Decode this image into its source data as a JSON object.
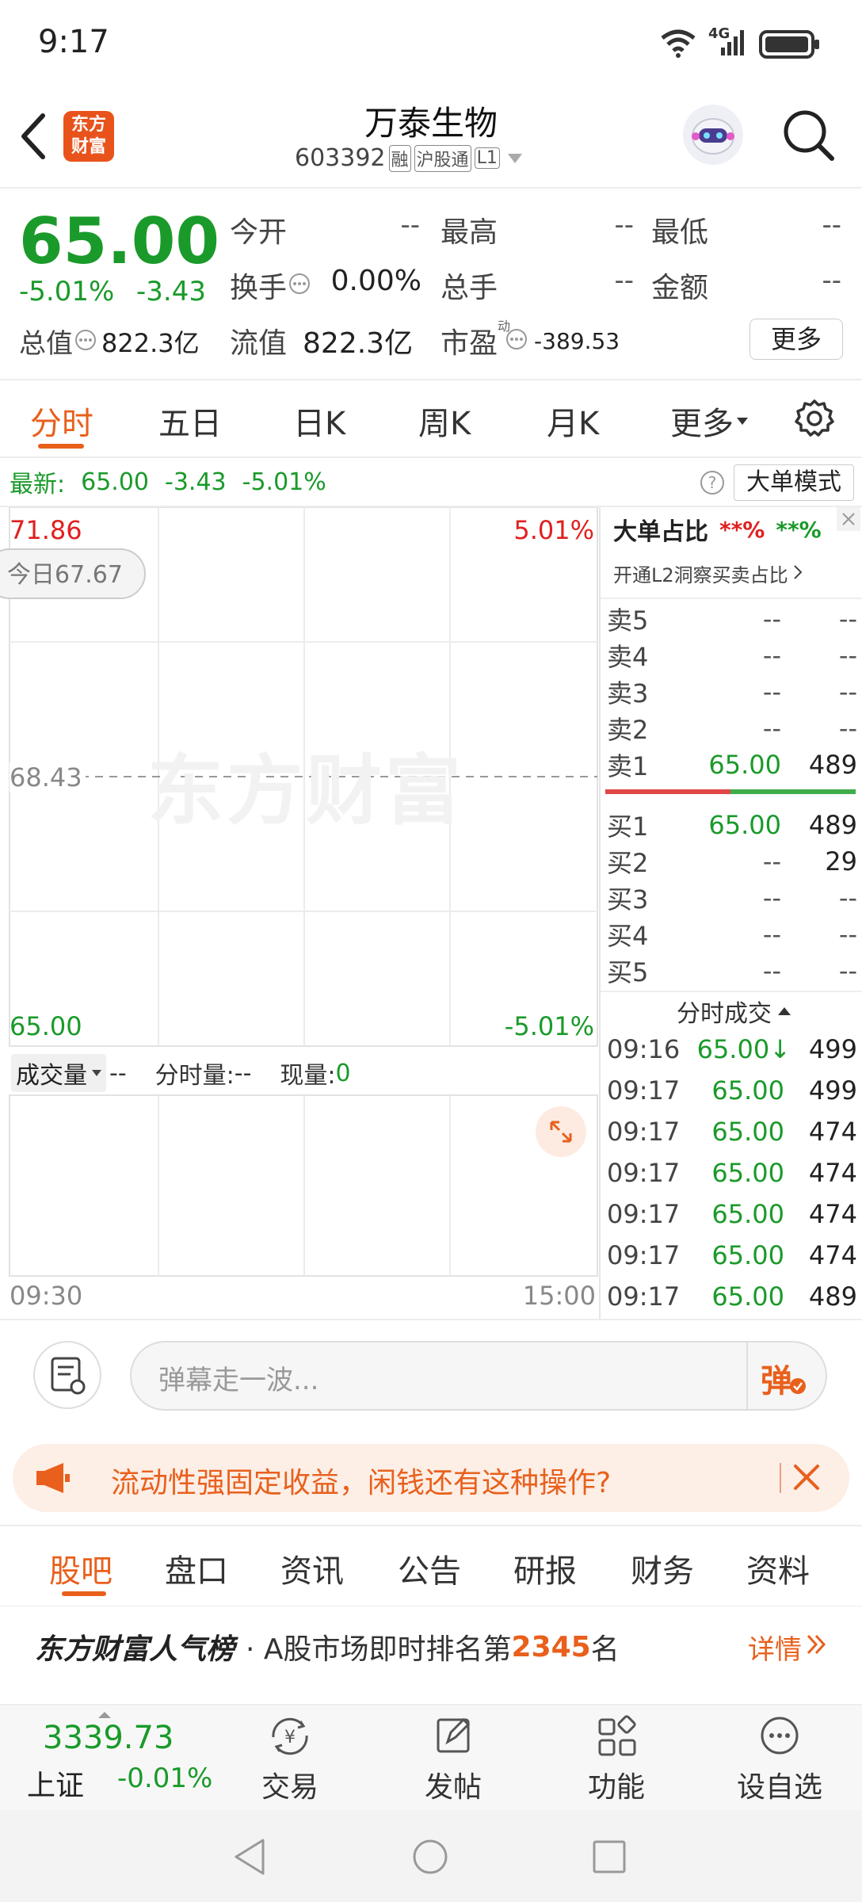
{
  "status_bar": {
    "time": "9:17",
    "network": "4G"
  },
  "header": {
    "logo_top": "东方",
    "logo_bottom": "财富",
    "stock_name": "万泰生物",
    "stock_code": "603392",
    "tags": [
      "融",
      "沪股通",
      "L1"
    ]
  },
  "quote": {
    "price": "65.00",
    "change_pct": "-5.01%",
    "change_abs": "-3.43",
    "open_label": "今开",
    "open_value": "--",
    "high_label": "最高",
    "high_value": "--",
    "low_label": "最低",
    "low_value": "--",
    "turnover_label": "换手",
    "turnover_value": "0.00%",
    "volume_label": "总手",
    "volume_value": "--",
    "amount_label": "金额",
    "amount_value": "--",
    "mktcap_label": "总值",
    "mktcap_value": "822.3亿",
    "float_label": "流值",
    "float_value": "822.3亿",
    "pe_label": "市盈",
    "pe_sup": "动",
    "pe_value": "-389.53",
    "more_button": "更多"
  },
  "chart_tabs": [
    "分时",
    "五日",
    "日K",
    "周K",
    "月K",
    "更多"
  ],
  "latest_bar": {
    "label": "最新:",
    "price": "65.00",
    "change": "-3.43",
    "pct": "-5.01%",
    "mode_button": "大单模式"
  },
  "chart": {
    "y_top": "71.86",
    "y_top_pct": "5.01%",
    "today_pill": "今日67.67",
    "y_mid": "68.43",
    "y_bottom": "65.00",
    "y_bottom_pct": "-5.01%",
    "watermark": "东方财富",
    "volume_selector": "成交量",
    "volume_value": "--",
    "period_vol_label": "分时量:",
    "period_vol_value": "--",
    "current_vol_label": "现量:",
    "current_vol_value": "0",
    "x_start": "09:30",
    "x_end": "15:00"
  },
  "order_book": {
    "title": "大单占比",
    "ratio_sell": "**%",
    "ratio_buy": "**%",
    "l2_link": "开通L2洞察买卖占比",
    "asks": [
      {
        "label": "卖5",
        "price": "--",
        "vol": "--"
      },
      {
        "label": "卖4",
        "price": "--",
        "vol": "--"
      },
      {
        "label": "卖3",
        "price": "--",
        "vol": "--"
      },
      {
        "label": "卖2",
        "price": "--",
        "vol": "--"
      },
      {
        "label": "卖1",
        "price": "65.00",
        "vol": "489"
      }
    ],
    "bids": [
      {
        "label": "买1",
        "price": "65.00",
        "vol": "489"
      },
      {
        "label": "买2",
        "price": "--",
        "vol": "29"
      },
      {
        "label": "买3",
        "price": "--",
        "vol": "--"
      },
      {
        "label": "买4",
        "price": "--",
        "vol": "--"
      },
      {
        "label": "买5",
        "price": "--",
        "vol": "--"
      }
    ],
    "ticks_title": "分时成交",
    "ticks": [
      {
        "time": "09:16",
        "price": "65.00↓",
        "vol": "499"
      },
      {
        "time": "09:17",
        "price": "65.00",
        "vol": "499"
      },
      {
        "time": "09:17",
        "price": "65.00",
        "vol": "474"
      },
      {
        "time": "09:17",
        "price": "65.00",
        "vol": "474"
      },
      {
        "time": "09:17",
        "price": "65.00",
        "vol": "474"
      },
      {
        "time": "09:17",
        "price": "65.00",
        "vol": "474"
      },
      {
        "time": "09:17",
        "price": "65.00",
        "vol": "489"
      }
    ]
  },
  "comment_bar": {
    "placeholder": "弹幕走一波...",
    "danmu_button": "弹"
  },
  "promo": {
    "text": "流动性强固定收益，闲钱还有这种操作?"
  },
  "sub_tabs": [
    "股吧",
    "盘口",
    "资讯",
    "公告",
    "研报",
    "财务",
    "资料"
  ],
  "ranking": {
    "brand": "东方财富人气榜",
    "text_prefix": "· A股市场即时排名第",
    "rank": "2345",
    "text_suffix": "名",
    "detail_link": "详情"
  },
  "bottom_nav": {
    "index_value": "3339.73",
    "index_name": "上证",
    "index_change": "-0.01%",
    "items": [
      "交易",
      "发帖",
      "功能",
      "设自选"
    ]
  },
  "colors": {
    "accent": "#e8601c",
    "up": "#e02020",
    "down": "#1a9a2a"
  }
}
